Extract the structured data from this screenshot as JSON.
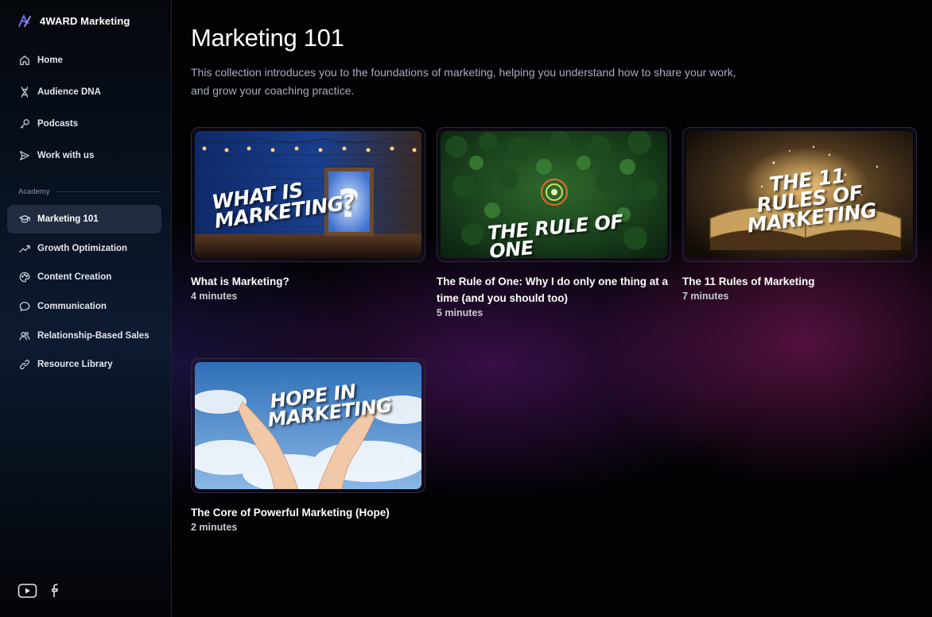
{
  "brand": {
    "name": "4WARD Marketing"
  },
  "nav": {
    "primary": [
      {
        "label": "Home",
        "icon": "home-icon"
      },
      {
        "label": "Audience DNA",
        "icon": "dna-icon"
      },
      {
        "label": "Podcasts",
        "icon": "microphone-icon"
      },
      {
        "label": "Work with us",
        "icon": "send-icon"
      }
    ],
    "section_label": "Academy",
    "academy": [
      {
        "label": "Marketing 101",
        "icon": "graduation-cap-icon",
        "active": true
      },
      {
        "label": "Growth Optimization",
        "icon": "trending-up-icon"
      },
      {
        "label": "Content Creation",
        "icon": "palette-icon"
      },
      {
        "label": "Communication",
        "icon": "chat-icon"
      },
      {
        "label": "Relationship-Based Sales",
        "icon": "users-icon"
      },
      {
        "label": "Resource Library",
        "icon": "link-icon"
      }
    ]
  },
  "social": [
    "youtube-icon",
    "facebook-icon"
  ],
  "page": {
    "title": "Marketing 101",
    "description": "This collection introduces you to the foundations of marketing, helping you understand how to share your work,  and grow your coaching practice."
  },
  "courses": [
    {
      "title": "What is Marketing?",
      "duration": "4 minutes",
      "thumb_text": "WHAT IS MARKETING?"
    },
    {
      "title": "The Rule of One: Why I do only one thing at a time (and you should too)",
      "duration": "5 minutes",
      "thumb_text": "THE RULE OF ONE"
    },
    {
      "title": "The 11 Rules of Marketing",
      "duration": "7 minutes",
      "thumb_text": "THE 11 RULES OF MARKETING"
    },
    {
      "title": "The Core of Powerful Marketing (Hope)",
      "duration": "2 minutes",
      "thumb_text": "HOPE IN MARKETING"
    }
  ],
  "colors": {
    "accent": "#7a5cff",
    "background": "#020205",
    "sidebar": "#0a1424"
  }
}
